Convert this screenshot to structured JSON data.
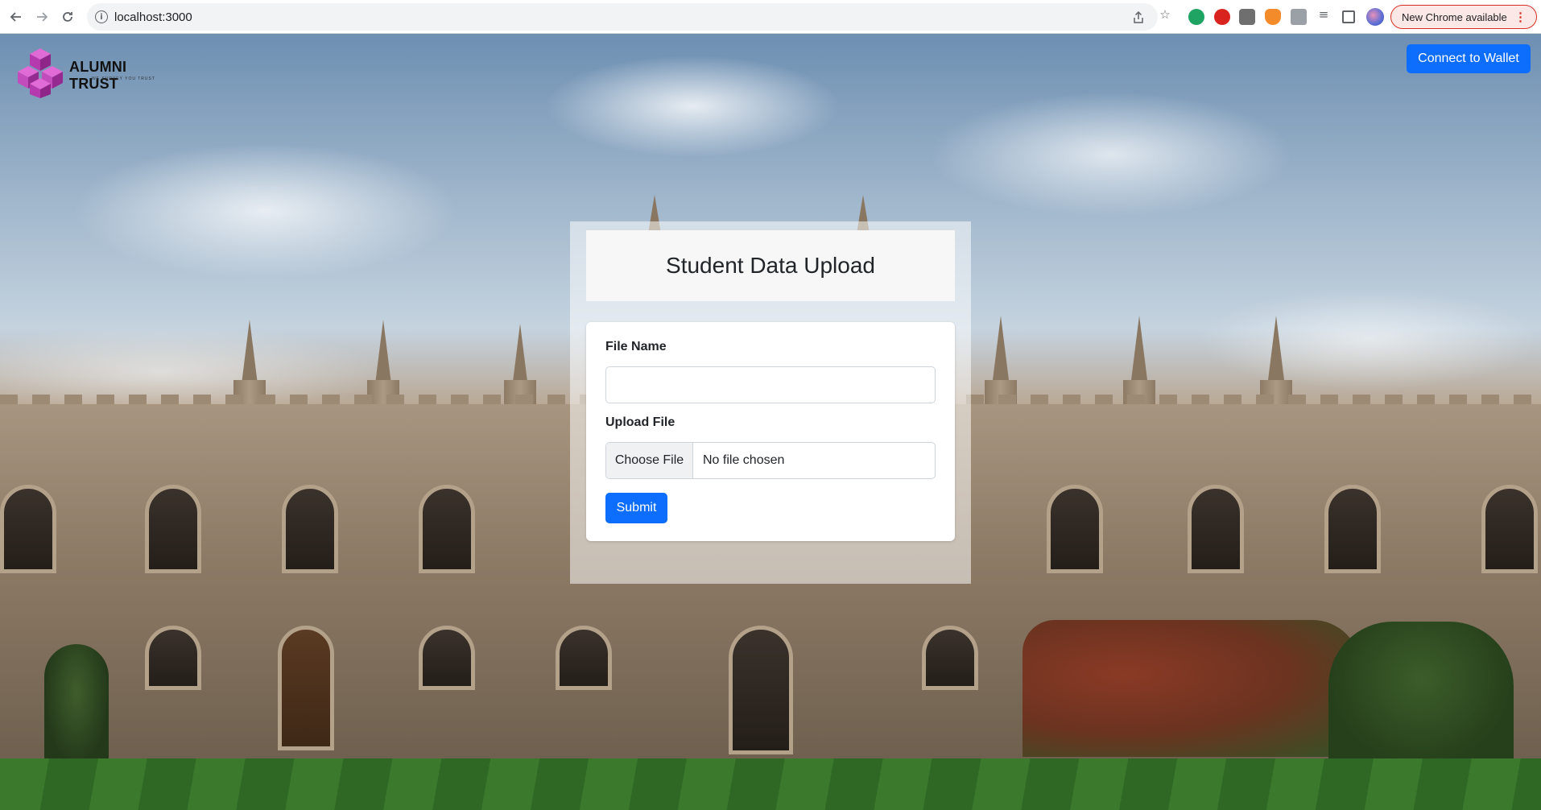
{
  "browser": {
    "url": "localhost:3000",
    "update_label": "New Chrome available",
    "menu_glyph": "⋮"
  },
  "brand": {
    "name": "ALUMNI TRUST",
    "tagline": "WE SURVEY YOU TRUST",
    "colors": {
      "cube_top": "#d94fd0",
      "cube_side": "#a92ea3",
      "cube_dark": "#7f1f7a"
    }
  },
  "header": {
    "wallet_button": "Connect to Wallet"
  },
  "upload": {
    "title": "Student Data Upload",
    "file_name_label": "File Name",
    "file_name_value": "",
    "upload_label": "Upload File",
    "choose_file": "Choose File",
    "no_file": "No file chosen",
    "submit": "Submit"
  },
  "theme": {
    "primary": "#0d6efd"
  }
}
